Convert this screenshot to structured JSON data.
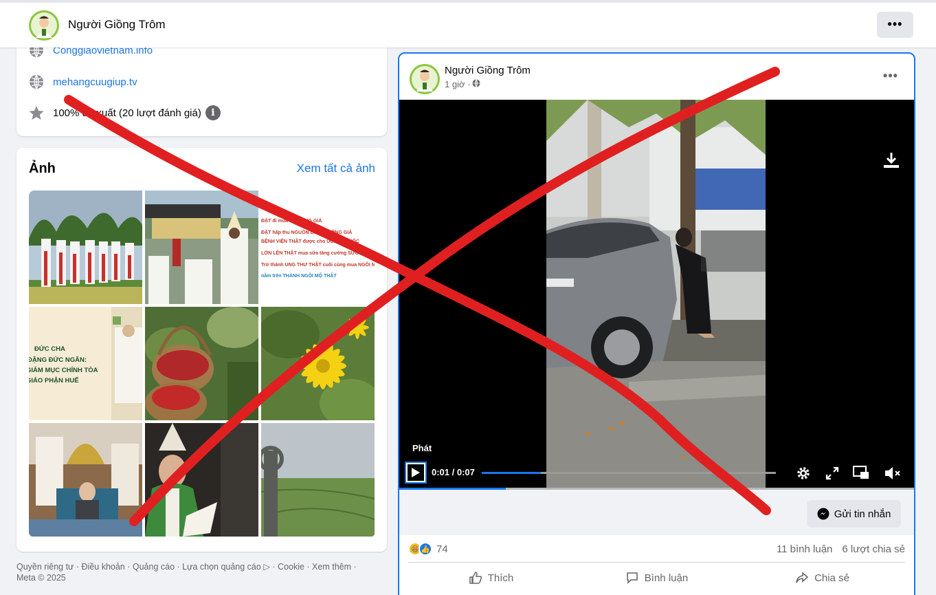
{
  "page": {
    "name": "Người Giồng Trôm",
    "more_label": "•••"
  },
  "intro": {
    "website_1": "Conggiaovietnam.info",
    "website_2": "mehangcuugiup.tv",
    "rating_text": "100% đề xuất (20 lượt đánh giá)",
    "info_label": "i"
  },
  "photos": {
    "title": "Ảnh",
    "see_all": "Xem tất cả ảnh",
    "card_text": [
      "ĐẶT đi mua MẬT ONG GIẢ",
      "ĐẶT hấp thu NGUỒN DINH DƯỠNG GIẢ",
      "BỆNH VIỆN THẬT được cho UỐNG THUỐC",
      "LỚN LÊN THẬT mua sữa tăng cường SỨC KHỎE",
      "Trở thành UNG THƯ THẬT cuối cùng mua NGÔI MỘ",
      "nằm trên THÀNH NGÔI MỘ THẬT"
    ],
    "bishop_text": [
      "ĐỨC CHA",
      "ĐẶNG ĐỨC NGÂN:",
      "GIÁM MỤC CHÍNH TÒA",
      "GIÁO PHẬN HUẾ"
    ]
  },
  "footer": {
    "text": "Quyền riêng tư · Điều khoản · Quảng cáo · Lựa chọn quảng cáo ▷ · Cookie · Xem thêm ·",
    "copyright": "Meta © 2025"
  },
  "post": {
    "author": "Người Giồng Trôm",
    "time": "1 giờ ·",
    "more_label": "•••",
    "video": {
      "play_label": "Phát",
      "time": "0:01 / 0:07",
      "progress": 0.2
    },
    "message_button": "Gửi tin nhắn",
    "reactions_count": "74",
    "comments": "11 bình luận",
    "shares": "6 lượt chia sẻ",
    "actions": {
      "like": "Thích",
      "comment": "Bình luận",
      "share": "Chia sẻ"
    }
  },
  "colors": {
    "accent": "#1877f2",
    "link": "#1b74e4",
    "overlay_x": "#e02020"
  }
}
